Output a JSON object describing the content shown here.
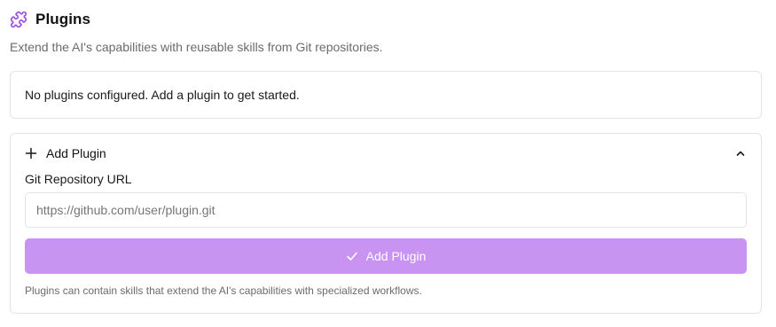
{
  "header": {
    "icon": "puzzle-icon",
    "title": "Plugins",
    "subtitle": "Extend the AI's capabilities with reusable skills from Git repositories."
  },
  "empty_state": {
    "message": "No plugins configured. Add a plugin to get started."
  },
  "add_section": {
    "toggle_icon": "plus-icon",
    "toggle_label": "Add Plugin",
    "collapse_icon": "chevron-up-icon",
    "field_label": "Git Repository URL",
    "url_placeholder": "https://github.com/user/plugin.git",
    "url_value": "",
    "submit_icon": "check-icon",
    "submit_label": "Add Plugin",
    "help_text": "Plugins can contain skills that extend the AI's capabilities with specialized workflows."
  },
  "colors": {
    "accent": "#9d4edd",
    "button_bg": "#c893f1",
    "border": "#e4e4e7",
    "muted_text": "#6b6b6b"
  }
}
